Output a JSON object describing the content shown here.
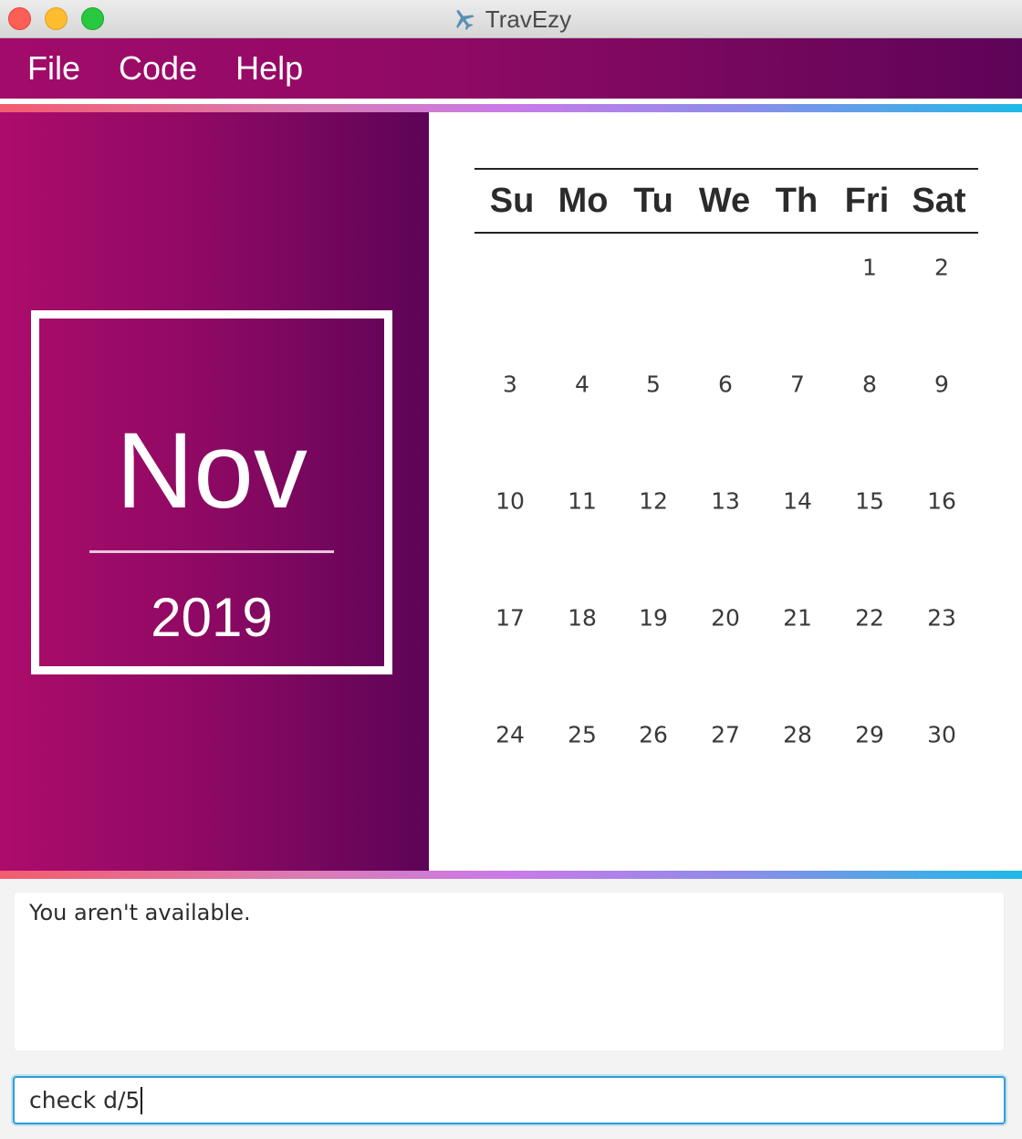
{
  "window": {
    "title": "TravEzy",
    "title_icon": "airplane-icon",
    "controls": [
      "close",
      "minimize",
      "zoom"
    ]
  },
  "menu": {
    "items": [
      {
        "label": "File"
      },
      {
        "label": "Code"
      },
      {
        "label": "Help"
      }
    ]
  },
  "month_panel": {
    "month": "Nov",
    "year": "2019"
  },
  "calendar": {
    "weekdays": [
      "Su",
      "Mo",
      "Tu",
      "We",
      "Th",
      "Fri",
      "Sat"
    ],
    "first_weekday_index": 5,
    "days_in_month": 30
  },
  "result_display": {
    "text": "You aren't available."
  },
  "command_box": {
    "value": "check d/5"
  },
  "colors": {
    "menubar_start": "#a20b6a",
    "menubar_end": "#5e0458",
    "accent_border": "#2b9fd9"
  }
}
